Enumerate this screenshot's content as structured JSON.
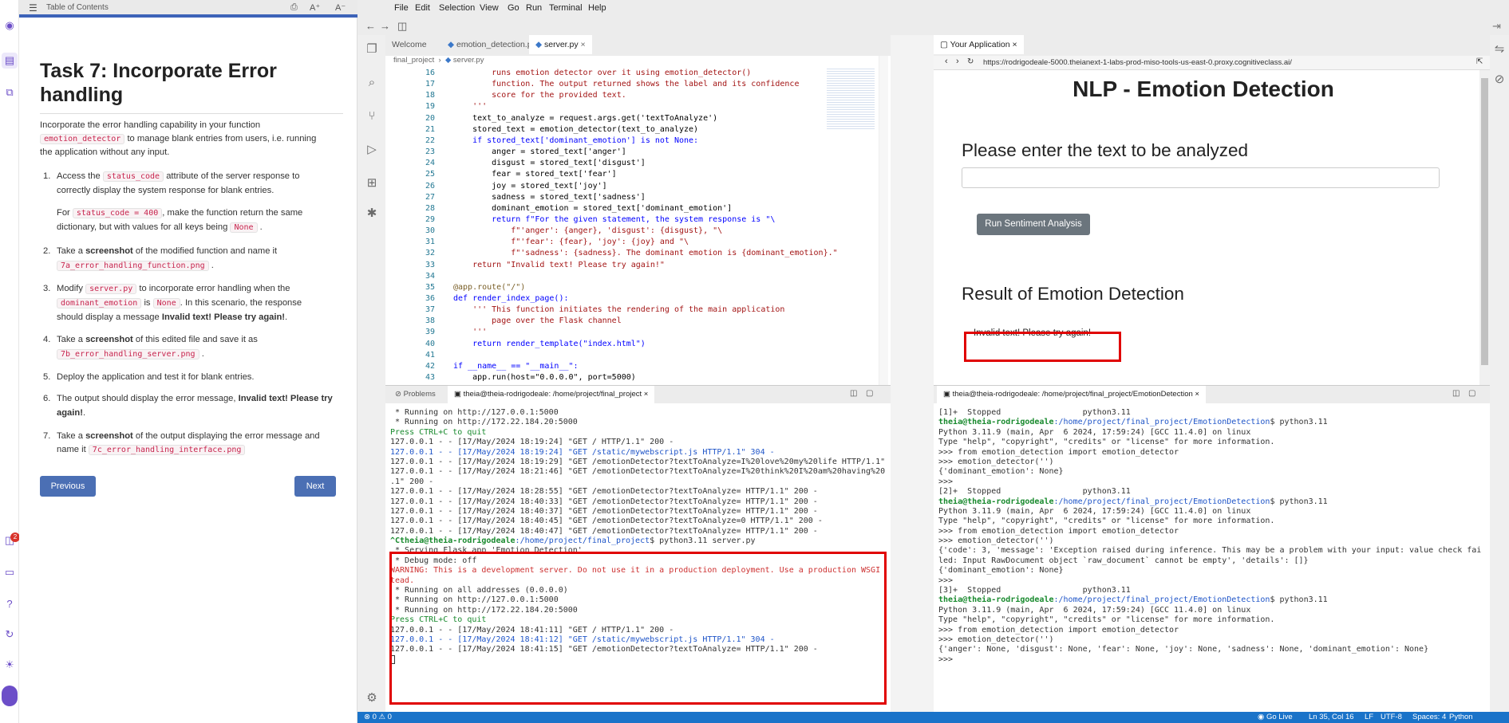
{
  "instructions": {
    "header_title": "Table of Contents",
    "title": "Task 7: Incorporate Error handling",
    "intro_before": "Incorporate the error handling capability in your function",
    "intro_code": "emotion_detector",
    "intro_after": "to manage blank entries from users, i.e. running",
    "intro_line3": "the application without any input.",
    "s1_num": "1.",
    "s1_a": "Access the",
    "s1_code": "status_code",
    "s1_b": "attribute of the server response to",
    "s1_c": "correctly display the system response for blank entries.",
    "s1_for": "For",
    "s1_code2": "status_code = 400",
    "s1_d": ", make the function return the same",
    "s1_e": "dictionary, but with values for all keys being",
    "s1_none": "None",
    "s1_dot": ".",
    "s2_num": "2.",
    "s2_a": "Take a",
    "s2_bold": "screenshot",
    "s2_b": "of the modified function and name it",
    "s2_code": "7a_error_handling_function.png",
    "s2_dot": ".",
    "s3_num": "3.",
    "s3_a": "Modify",
    "s3_code": "server.py",
    "s3_b": "to incorporate error handling when the",
    "s3_code2": "dominant_emotion",
    "s3_is": "is",
    "s3_none": "None",
    "s3_c": ". In this scenario, the response",
    "s3_d": "should display a message",
    "s3_bold": "Invalid text! Please try again!",
    "s3_dot": ".",
    "s4_num": "4.",
    "s4_a": "Take a",
    "s4_bold": "screenshot",
    "s4_b": "of this edited file and save it as",
    "s4_code": "7b_error_handling_server.png",
    "s4_dot": ".",
    "s5_num": "5.",
    "s5_a": "Deploy the application and test it for blank entries.",
    "s6_num": "6.",
    "s6_a": "The output should display the error message,",
    "s6_bold1": "Invalid text! Please try",
    "s6_bold2": "again!",
    "s6_dot": ".",
    "s7_num": "7.",
    "s7_a": "Take a",
    "s7_bold": "screenshot",
    "s7_b": "of the output displaying the error message and",
    "s7_c": "name it",
    "s7_code": "7c_error_handling_interface.png",
    "prev": "Previous",
    "next": "Next",
    "badge": "2"
  },
  "ide": {
    "menus": [
      "File",
      "Edit",
      "Selection",
      "View",
      "Go",
      "Run",
      "Terminal",
      "Help"
    ],
    "tabs": [
      "Welcome",
      "emotion_detection.py",
      "server.py"
    ],
    "breadcrumb": [
      "final_project",
      "server.py"
    ],
    "app_tab": "Your Application",
    "app_url": "https://rodrigodeale-5000.theianext-1-labs-prod-miso-tools-us-east-0.proxy.cognitiveclass.ai/",
    "code_lines": [
      {
        "n": "16",
        "t": "        runs emotion detector over it using emotion_detector()"
      },
      {
        "n": "17",
        "t": "        function. The output returned shows the label and its confidence"
      },
      {
        "n": "18",
        "t": "        score for the provided text."
      },
      {
        "n": "19",
        "t": "    '''"
      },
      {
        "n": "20",
        "t": "    text_to_analyze = request.args.get('textToAnalyze')"
      },
      {
        "n": "21",
        "t": "    stored_text = emotion_detector(text_to_analyze)"
      },
      {
        "n": "22",
        "t": "    if stored_text['dominant_emotion'] is not None:"
      },
      {
        "n": "23",
        "t": "        anger = stored_text['anger']"
      },
      {
        "n": "24",
        "t": "        disgust = stored_text['disgust']"
      },
      {
        "n": "25",
        "t": "        fear = stored_text['fear']"
      },
      {
        "n": "26",
        "t": "        joy = stored_text['joy']"
      },
      {
        "n": "27",
        "t": "        sadness = stored_text['sadness']"
      },
      {
        "n": "28",
        "t": "        dominant_emotion = stored_text['dominant_emotion']"
      },
      {
        "n": "29",
        "t": "        return f\"For the given statement, the system response is \"\\"
      },
      {
        "n": "30",
        "t": "            f\"'anger': {anger}, 'disgust': {disgust}, \"\\"
      },
      {
        "n": "31",
        "t": "            f\"'fear': {fear}, 'joy': {joy} and \"\\"
      },
      {
        "n": "32",
        "t": "            f\"'sadness': {sadness}. The dominant emotion is {dominant_emotion}.\""
      },
      {
        "n": "33",
        "t": "    return \"Invalid text! Please try again!\""
      },
      {
        "n": "34",
        "t": ""
      },
      {
        "n": "35",
        "t": "@app.route(\"/\")"
      },
      {
        "n": "36",
        "t": "def render_index_page():"
      },
      {
        "n": "37",
        "t": "    ''' This function initiates the rendering of the main application"
      },
      {
        "n": "38",
        "t": "        page over the Flask channel"
      },
      {
        "n": "39",
        "t": "    '''"
      },
      {
        "n": "40",
        "t": "    return render_template(\"index.html\")"
      },
      {
        "n": "41",
        "t": ""
      },
      {
        "n": "42",
        "t": "if __name__ == \"__main__\":"
      },
      {
        "n": "43",
        "t": "    app.run(host=\"0.0.0.0\", port=5000)"
      }
    ],
    "app_page": {
      "title": "NLP - Emotion Detection",
      "prompt": "Please enter the text to be analyzed",
      "button": "Run Sentiment Analysis",
      "result_title": "Result of Emotion Detection",
      "result_text": "Invalid text! Please try again!"
    },
    "term1_tabs": [
      "Problems",
      "theia@theia-rodrigodeale: /home/project/final_project"
    ],
    "term2_tab": "theia@theia-rodrigodeale: /home/project/final_project/EmotionDetection",
    "term1_lines": [
      " * Running on http://127.0.0.1:5000",
      " * Running on http://172.22.184.20:5000",
      "Press CTRL+C to quit",
      "127.0.0.1 - - [17/May/2024 18:19:24] \"GET / HTTP/1.1\" 200 -",
      "127.0.0.1 - - [17/May/2024 18:19:24] \"GET /static/mywebscript.js HTTP/1.1\" 304 -",
      "127.0.0.1 - - [17/May/2024 18:19:29] \"GET /emotionDetector?textToAnalyze=I%20love%20my%20life HTTP/1.1\" 200 -",
      "127.0.0.1 - - [17/May/2024 18:21:46] \"GET /emotionDetector?textToAnalyze=I%20think%20I%20am%20having%20fun HTTP/1",
      ".1\" 200 -",
      "127.0.0.1 - - [17/May/2024 18:28:55] \"GET /emotionDetector?textToAnalyze= HTTP/1.1\" 200 -",
      "127.0.0.1 - - [17/May/2024 18:40:33] \"GET /emotionDetector?textToAnalyze= HTTP/1.1\" 200 -",
      "127.0.0.1 - - [17/May/2024 18:40:37] \"GET /emotionDetector?textToAnalyze= HTTP/1.1\" 200 -",
      "127.0.0.1 - - [17/May/2024 18:40:45] \"GET /emotionDetector?textToAnalyze=0 HTTP/1.1\" 200 -",
      "127.0.0.1 - - [17/May/2024 18:40:47] \"GET /emotionDetector?textToAnalyze= HTTP/1.1\" 200 -"
    ],
    "term1_prompt_user": "^Ctheia@theia-rodrigodeale",
    "term1_prompt_path": ":/home/project/final_project",
    "term1_prompt_cmd": "$ python3.11 server.py",
    "term1_box_lines": [
      " * Serving Flask app 'Emotion Detection'",
      " * Debug mode: off"
    ],
    "term1_warning1": "WARNING: This is a development server. Do not use it in a production deployment. Use a production WSGI server ins",
    "term1_warning2": "tead.",
    "term1_box_lines2": [
      " * Running on all addresses (0.0.0.0)",
      " * Running on http://127.0.0.1:5000",
      " * Running on http://172.22.184.20:5000"
    ],
    "term1_quit": "Press CTRL+C to quit",
    "term1_box_lines3": [
      "127.0.0.1 - - [17/May/2024 18:41:11] \"GET / HTTP/1.1\" 200 -",
      "127.0.0.1 - - [17/May/2024 18:41:12] \"GET /static/mywebscript.js HTTP/1.1\" 304 -",
      "127.0.0.1 - - [17/May/2024 18:41:15] \"GET /emotionDetector?textToAnalyze= HTTP/1.1\" 200 -"
    ],
    "term2_lines": [
      "[1]+  Stopped                 python3.11",
      "theia@theia-rodrigodeale:/home/project/final_project/EmotionDetection$ python3.11",
      "Python 3.11.9 (main, Apr  6 2024, 17:59:24) [GCC 11.4.0] on linux",
      "Type \"help\", \"copyright\", \"credits\" or \"license\" for more information.",
      ">>> from emotion_detection import emotion_detector",
      ">>> emotion_detector('')",
      "{'dominant_emotion': None}",
      ">>>",
      "[2]+  Stopped                 python3.11",
      "theia@theia-rodrigodeale:/home/project/final_project/EmotionDetection$ python3.11",
      "Python 3.11.9 (main, Apr  6 2024, 17:59:24) [GCC 11.4.0] on linux",
      "Type \"help\", \"copyright\", \"credits\" or \"license\" for more information.",
      ">>> from emotion_detection import emotion_detector",
      ">>> emotion_detector('')",
      "{'code': 3, 'message': 'Exception raised during inference. This may be a problem with your input: value check fai",
      "led: Input RawDocument object `raw_document` cannot be empty', 'details': []}",
      "{'dominant_emotion': None}",
      ">>>",
      "[3]+  Stopped                 python3.11",
      "theia@theia-rodrigodeale:/home/project/final_project/EmotionDetection$ python3.11",
      "Python 3.11.9 (main, Apr  6 2024, 17:59:24) [GCC 11.4.0] on linux",
      "Type \"help\", \"copyright\", \"credits\" or \"license\" for more information.",
      ">>> from emotion_detection import emotion_detector",
      ">>> emotion_detector('')",
      "{'anger': None, 'disgust': None, 'fear': None, 'joy': None, 'sadness': None, 'dominant_emotion': None}",
      ">>> "
    ],
    "status": {
      "left": "⊗ 0 ⚠ 0",
      "golive": "Go Live",
      "pos": "Ln 35, Col 16",
      "eol": "LF",
      "enc": "UTF-8",
      "spaces": "Spaces: 4",
      "lang": "Python"
    }
  }
}
